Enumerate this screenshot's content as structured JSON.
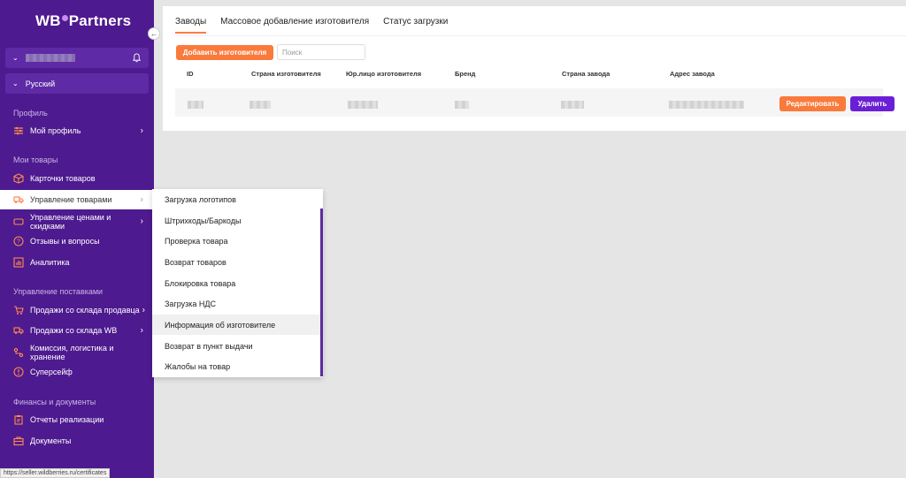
{
  "sidebar": {
    "logo": {
      "part1": "WB",
      "part2": "Partners"
    },
    "language": "Русский",
    "sections": {
      "profile": "Профиль",
      "goods": "Мои товары",
      "supplies": "Управление поставками",
      "finance": "Финансы и документы"
    },
    "items": {
      "my_profile": "Мой профиль",
      "cards": "Карточки товаров",
      "manage_goods": "Управление товарами",
      "prices_line1": "Управление ценами и",
      "prices_line2": "скидками",
      "reviews": "Отзывы и вопросы",
      "analytics": "Аналитика",
      "sales_seller": "Продажи со склада продавца",
      "sales_wb": "Продажи со склада WB",
      "commission_line1": "Комиссия, логистика и",
      "commission_line2": "хранение",
      "supersafe": "Суперсейф",
      "reports": "Отчеты реализации",
      "documents": "Документы"
    },
    "accent_color": "#4e1a8f"
  },
  "status_url": "https://seller.wildberries.ru/certificates",
  "tabs": [
    "Заводы",
    "Массовое добавление изготовителя",
    "Статус загрузки"
  ],
  "toolbar": {
    "add_label": "Добавить изготовителя",
    "search_placeholder": "Поиск"
  },
  "table": {
    "headers": [
      "ID",
      "Страна изготовителя",
      "Юр.лицо изготовителя",
      "Бренд",
      "Страна завода",
      "Адрес завода"
    ],
    "edit_label": "Редактировать",
    "delete_label": "Удалить"
  },
  "submenu": [
    "Загрузка логотипов",
    "Штрихкоды/Баркоды",
    "Проверка товара",
    "Возврат товаров",
    "Блокировка товара",
    "Загрузка НДС",
    "Информация об изготовителе",
    "Возврат в пункт выдачи",
    "Жалобы на товар"
  ],
  "colors": {
    "orange": "#fa7a3c",
    "purple_button": "#6a1fd6"
  }
}
